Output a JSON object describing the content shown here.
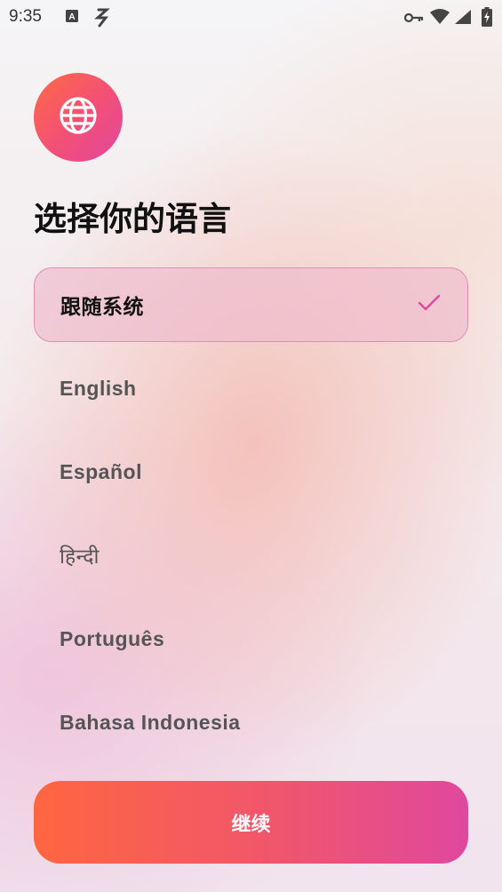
{
  "status_bar": {
    "time": "9:35",
    "left_icons": [
      "a-notification-icon",
      "flash-icon"
    ],
    "right_icons": [
      "vpn-key-icon",
      "wifi-icon",
      "signal-icon",
      "battery-charging-icon"
    ]
  },
  "header": {
    "logo_icon": "globe-icon",
    "title": "选择你的语言"
  },
  "languages": {
    "selected_index": 0,
    "items": [
      {
        "label": "跟随系统"
      },
      {
        "label": "English"
      },
      {
        "label": "Español"
      },
      {
        "label": "हिन्दी"
      },
      {
        "label": "Português"
      },
      {
        "label": "Bahasa Indonesia"
      }
    ]
  },
  "footer": {
    "continue_label": "继续"
  },
  "colors": {
    "accent_start": "#ff6640",
    "accent_end": "#e0489e",
    "selected_border": "#e58cb4",
    "check": "#e0489e"
  }
}
